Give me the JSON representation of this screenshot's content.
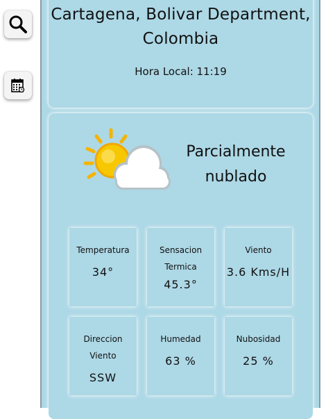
{
  "sidebar": {
    "search_icon": "search-icon",
    "calendar_icon": "calendar-icon"
  },
  "location": {
    "city": "Cartagena, Bolivar Department, Colombia",
    "local_time": "Hora Local: 11:19"
  },
  "current": {
    "condition_icon": "partly-cloudy-icon",
    "condition": "Parcialmente nublado",
    "stats": [
      {
        "label": "Temperatura",
        "value": "34°"
      },
      {
        "label": "Sensacion Termica",
        "value": "45.3°"
      },
      {
        "label": "Viento",
        "value": "3.6 Kms/H"
      },
      {
        "label": "Direccion Viento",
        "value": "SSW"
      },
      {
        "label": "Humedad",
        "value": "63 %"
      },
      {
        "label": "Nubosidad",
        "value": "25 %"
      }
    ]
  },
  "colors": {
    "panel": "#add8e6",
    "sun": "#f5c400",
    "cloud": "#ffffff"
  }
}
